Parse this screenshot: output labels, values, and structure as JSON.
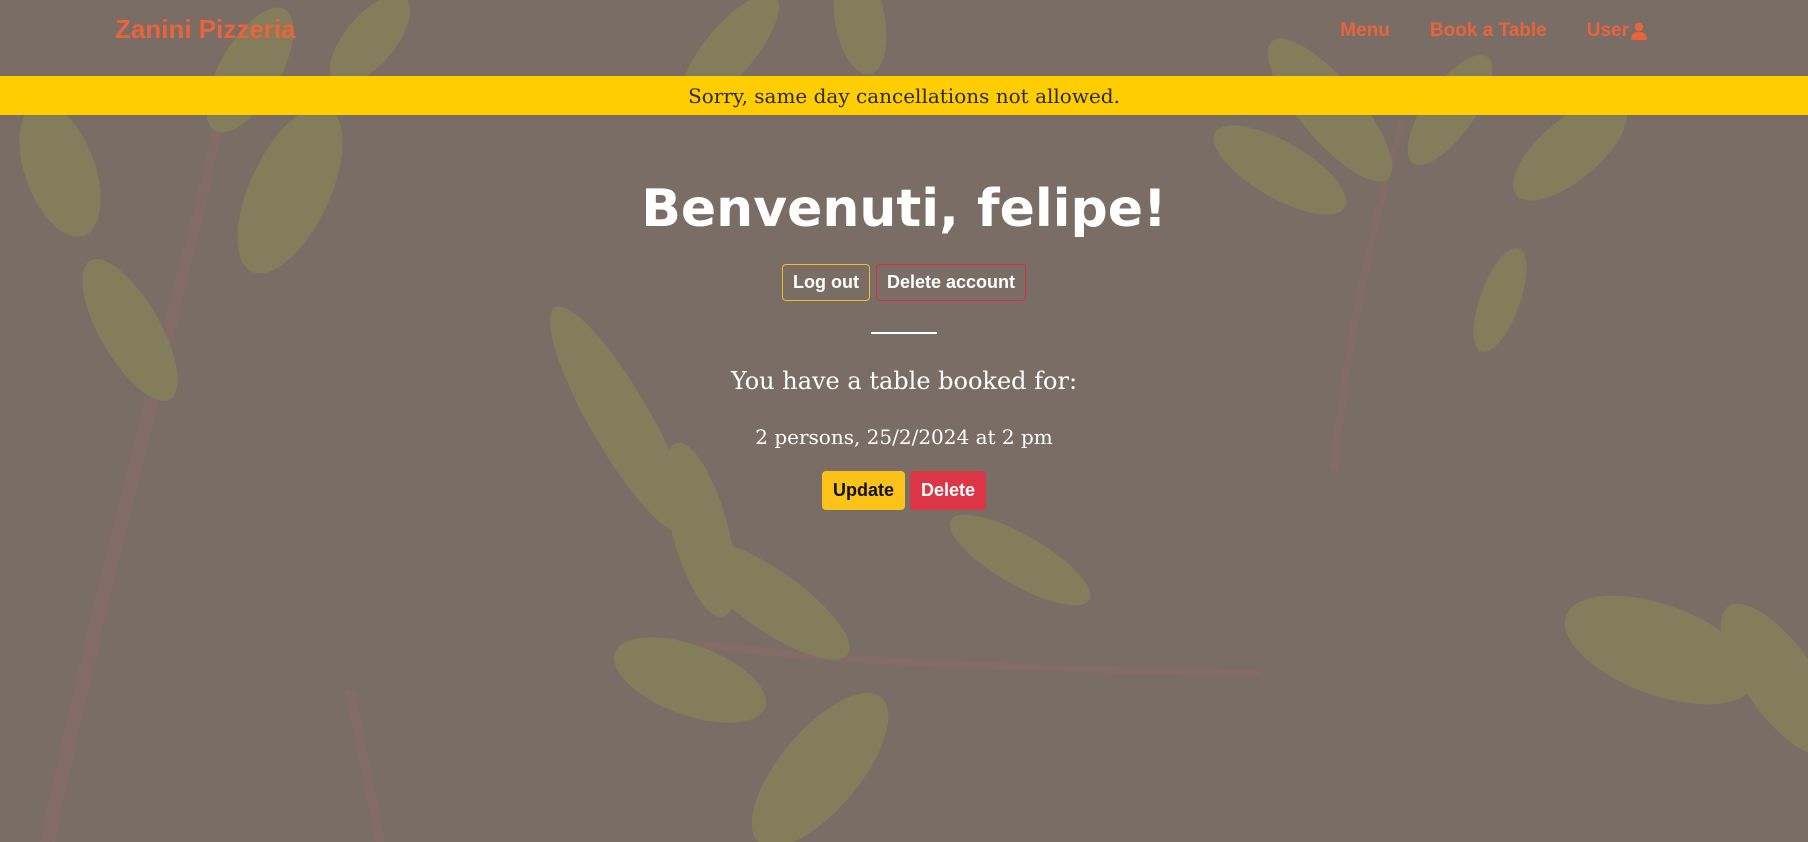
{
  "navbar": {
    "brand": "Zanini Pizzeria",
    "links": [
      {
        "label": "Menu"
      },
      {
        "label": "Book a Table"
      },
      {
        "label": "User",
        "icon": "user-icon"
      }
    ]
  },
  "alert": {
    "message": "Sorry, same day cancellations not allowed."
  },
  "main": {
    "welcome": "Benvenuti, felipe!",
    "logout_label": "Log out",
    "delete_account_label": "Delete account",
    "booked_heading": "You have a table booked for:",
    "booking_detail": "2 persons, 25/2/2024 at 2 pm",
    "update_label": "Update",
    "delete_label": "Delete"
  },
  "colors": {
    "brand": "#e8643c",
    "alert_bg": "#ffcd00",
    "update": "#fbc21a",
    "delete": "#dc3545",
    "background_overlay": "#7a6d65"
  }
}
